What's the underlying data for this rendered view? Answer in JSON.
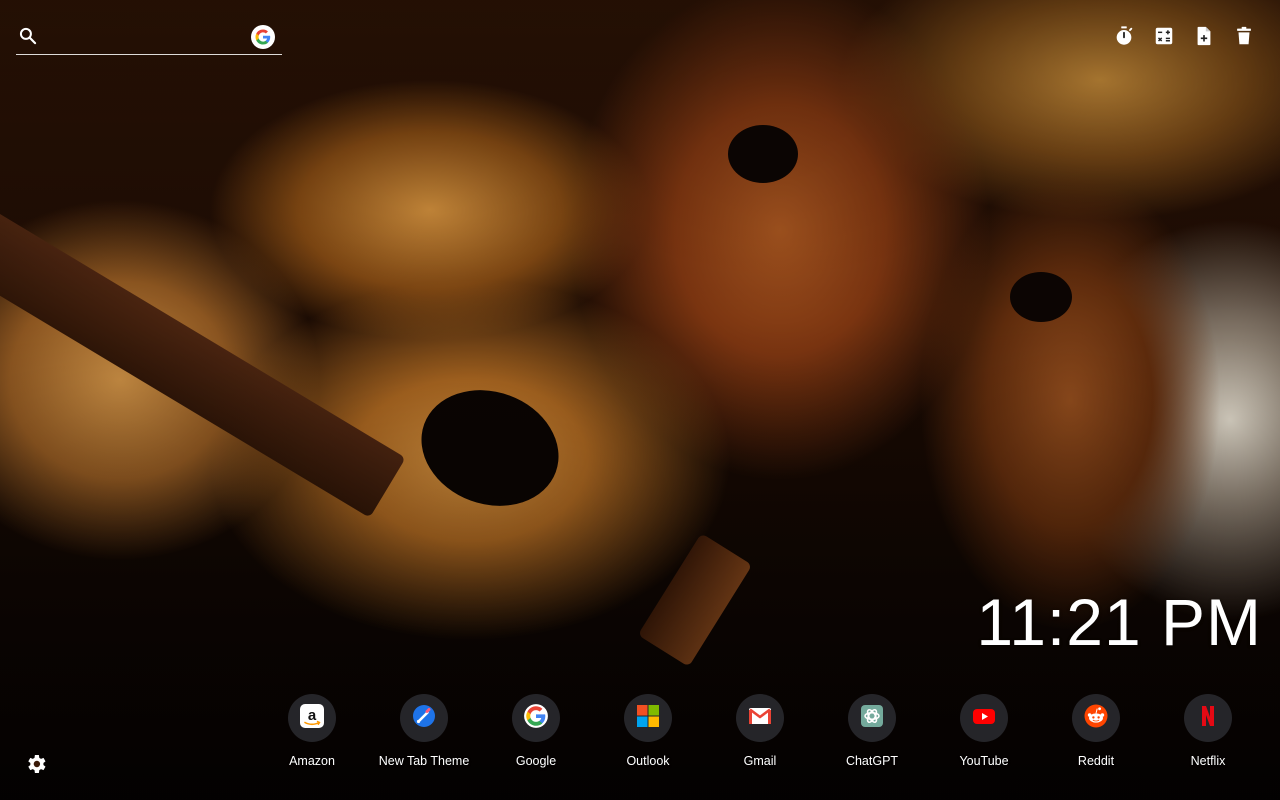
{
  "search": {
    "placeholder": "",
    "value": ""
  },
  "toolbar": {
    "items": [
      {
        "name": "timer-icon"
      },
      {
        "name": "calculator-icon"
      },
      {
        "name": "note-add-icon"
      },
      {
        "name": "trash-icon"
      }
    ]
  },
  "clock": {
    "time": "11:21 PM"
  },
  "shortcuts": [
    {
      "label": "Amazon",
      "icon": "amazon-icon"
    },
    {
      "label": "New Tab Theme",
      "icon": "new-tab-theme-icon"
    },
    {
      "label": "Google",
      "icon": "google-icon"
    },
    {
      "label": "Outlook",
      "icon": "outlook-icon"
    },
    {
      "label": "Gmail",
      "icon": "gmail-icon"
    },
    {
      "label": "ChatGPT",
      "icon": "chatgpt-icon"
    },
    {
      "label": "YouTube",
      "icon": "youtube-icon"
    },
    {
      "label": "Reddit",
      "icon": "reddit-icon"
    },
    {
      "label": "Netflix",
      "icon": "netflix-icon"
    }
  ],
  "settings": {
    "icon": "gear-icon"
  },
  "colors": {
    "google_blue": "#4285F4",
    "google_red": "#EA4335",
    "google_yellow": "#FBBC05",
    "google_green": "#34A853",
    "youtube_red": "#FF0000",
    "reddit_orange": "#FF4500",
    "netflix_red": "#E50914",
    "chatgpt_teal": "#74AA9C"
  }
}
